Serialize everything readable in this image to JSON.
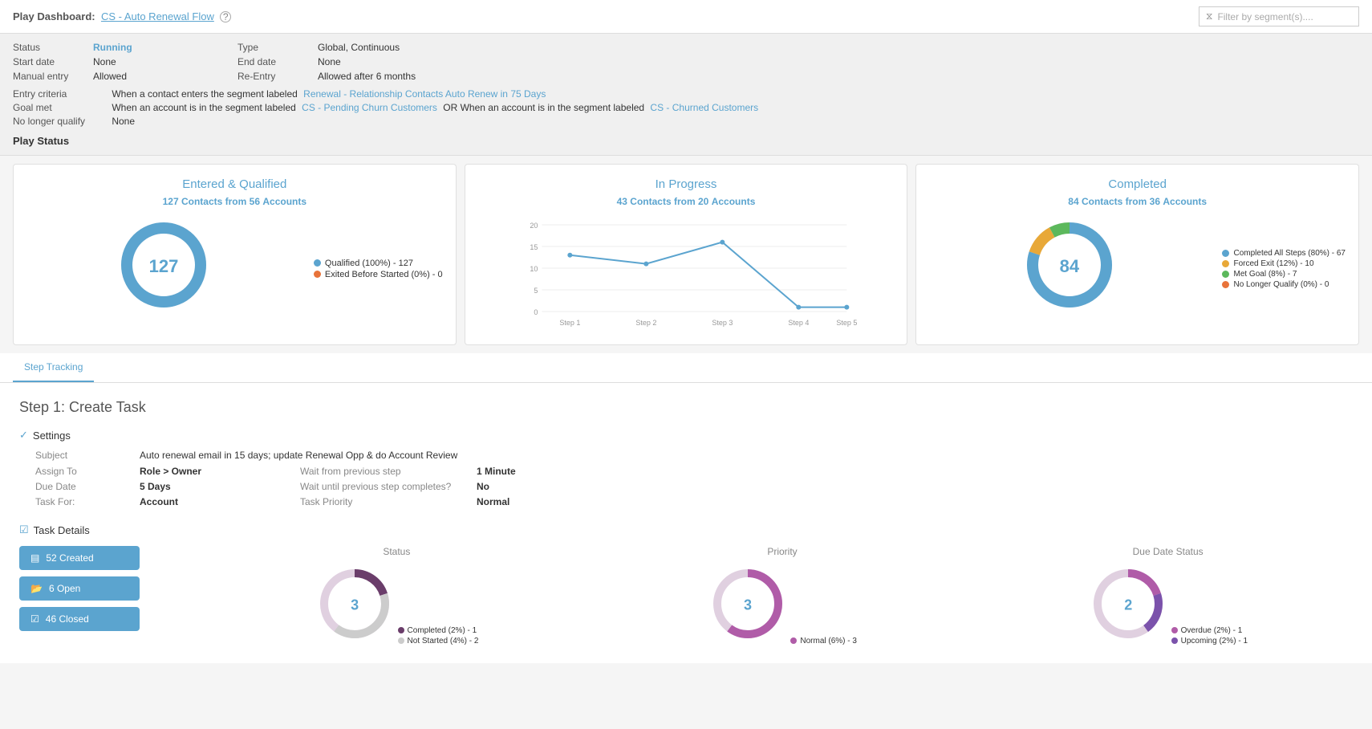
{
  "header": {
    "prefix": "Play Dashboard:",
    "link_label": "CS - Auto Renewal Flow",
    "help_icon": "?",
    "filter_placeholder": "Filter by segment(s)...."
  },
  "info": {
    "status_label": "Status",
    "status_value": "Running",
    "type_label": "Type",
    "type_value": "Global, Continuous",
    "start_date_label": "Start date",
    "start_date_value": "None",
    "end_date_label": "End date",
    "end_date_value": "None",
    "manual_entry_label": "Manual entry",
    "manual_entry_value": "Allowed",
    "reentry_label": "Re-Entry",
    "reentry_value": "Allowed after 6 months",
    "entry_criteria_label": "Entry criteria",
    "entry_criteria_text": "When a contact enters the segment labeled",
    "entry_criteria_link": "Renewal - Relationship Contacts Auto Renew in 75 Days",
    "goal_met_label": "Goal met",
    "goal_met_text": "When an account is in the segment labeled",
    "goal_met_link1": "CS - Pending Churn Customers",
    "goal_met_or": "OR When an account is in the segment labeled",
    "goal_met_link2": "CS - Churned Customers",
    "no_longer_label": "No longer qualify",
    "no_longer_value": "None",
    "play_status_title": "Play Status"
  },
  "entered_qualified": {
    "title": "Entered & Qualified",
    "subtitle_contacts": "127",
    "subtitle_from": "from",
    "subtitle_accounts": "56",
    "subtitle_accounts_label": "Accounts",
    "donut_center": "127",
    "qualified_pct": "Qualified (100%) - 127",
    "exited_pct": "Exited Before Started (0%) - 0",
    "qualified_color": "#5ba4cf",
    "exited_color": "#e8733a"
  },
  "in_progress": {
    "title": "In Progress",
    "subtitle_contacts": "43",
    "subtitle_accounts": "20",
    "subtitle_accounts_label": "Accounts",
    "chart_points": [
      {
        "step": "Step 1",
        "value": 13
      },
      {
        "step": "Step 2",
        "value": 11
      },
      {
        "step": "Step 3",
        "value": 16
      },
      {
        "step": "Step 4",
        "value": 1
      },
      {
        "step": "Step 5",
        "value": 1
      }
    ],
    "y_max": 20,
    "y_labels": [
      0,
      5,
      10,
      15,
      20
    ]
  },
  "completed": {
    "title": "Completed",
    "subtitle_contacts": "84",
    "subtitle_accounts": "36",
    "subtitle_accounts_label": "Accounts",
    "donut_center": "84",
    "legend": [
      {
        "label": "Completed All Steps (80%) - 67",
        "color": "#5ba4cf"
      },
      {
        "label": "Forced Exit (12%) - 10",
        "color": "#e8a838"
      },
      {
        "label": "Met Goal (8%) - 7",
        "color": "#5cb85c"
      },
      {
        "label": "No Longer Qualify (0%) - 0",
        "color": "#e8733a"
      }
    ]
  },
  "tabs": [
    {
      "label": "Step Tracking",
      "active": true
    }
  ],
  "step1": {
    "heading": "Step 1: Create Task",
    "settings_title": "Settings",
    "subject_label": "Subject",
    "subject_value": "Auto renewal email in 15 days; update Renewal Opp & do Account Review",
    "assign_to_label": "Assign To",
    "assign_to_value": "Role > Owner",
    "wait_prev_label": "Wait from previous step",
    "wait_prev_value": "1 Minute",
    "due_date_label": "Due Date",
    "due_date_value": "5 Days",
    "wait_complete_label": "Wait until previous step completes?",
    "wait_complete_value": "No",
    "task_for_label": "Task For:",
    "task_for_value": "Account",
    "task_priority_label": "Task Priority",
    "task_priority_value": "Normal",
    "task_details_title": "Task Details",
    "btn_created_label": "52 Created",
    "btn_open_label": "6 Open",
    "btn_closed_label": "46 Closed",
    "status_chart_title": "Status",
    "status_center": "3",
    "status_legend": [
      {
        "label": "Completed (2%) - 1",
        "color": "#6a3d6a"
      },
      {
        "label": "Not Started (4%) - 2",
        "color": "#ccc"
      }
    ],
    "priority_chart_title": "Priority",
    "priority_center": "3",
    "priority_legend": [
      {
        "label": "Normal (6%) - 3",
        "color": "#b05ca8"
      }
    ],
    "due_date_chart_title": "Due Date Status",
    "due_date_center": "2",
    "due_date_legend": [
      {
        "label": "Overdue (2%) - 1",
        "color": "#b05ca8"
      },
      {
        "label": "Upcoming (2%) - 1",
        "color": "#7b52ab"
      }
    ]
  },
  "colors": {
    "primary": "#5ba4cf",
    "accent_orange": "#e8a838",
    "accent_green": "#5cb85c",
    "accent_red": "#e8733a",
    "purple_dark": "#6a3d6a",
    "purple_medium": "#b05ca8",
    "purple_light": "#7b52ab"
  }
}
